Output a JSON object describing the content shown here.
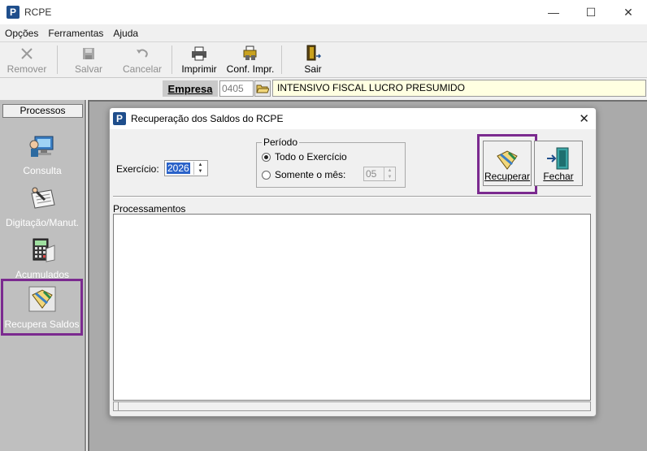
{
  "window": {
    "title": "RCPE",
    "app_icon_letter": "P",
    "controls": {
      "minimize": "—",
      "maximize": "☐",
      "close": "✕"
    }
  },
  "menu": [
    "Opções",
    "Ferramentas",
    "Ajuda"
  ],
  "toolbar": {
    "remover": "Remover",
    "salvar": "Salvar",
    "cancelar": "Cancelar",
    "imprimir": "Imprimir",
    "conf_impr": "Conf. Impr.",
    "sair": "Sair"
  },
  "empresa": {
    "label": "Empresa",
    "code": "0405",
    "name": "INTENSIVO FISCAL LUCRO PRESUMIDO"
  },
  "sidebar": {
    "header": "Processos",
    "items": [
      {
        "label": "Consulta",
        "icon": "computer-user-icon"
      },
      {
        "label": "Digitação/Manut.",
        "icon": "handwriting-icon"
      },
      {
        "label": "Acumulados",
        "icon": "calculator-icon"
      },
      {
        "label": "Recupera Saldos",
        "icon": "recover-folder-icon",
        "selected": true
      }
    ]
  },
  "dialog": {
    "title": "Recuperação dos Saldos do RCPE",
    "icon_letter": "P",
    "close": "✕",
    "exercicio_label": "Exercício:",
    "exercicio_value": "2026",
    "periodo_legend": "Período",
    "radio_todo": "Todo o Exercício",
    "radio_somente": "Somente o mês:",
    "mes_value": "05",
    "recuperar": "Recuperar",
    "fechar": "Fechar",
    "processamentos_label": "Processamentos"
  }
}
